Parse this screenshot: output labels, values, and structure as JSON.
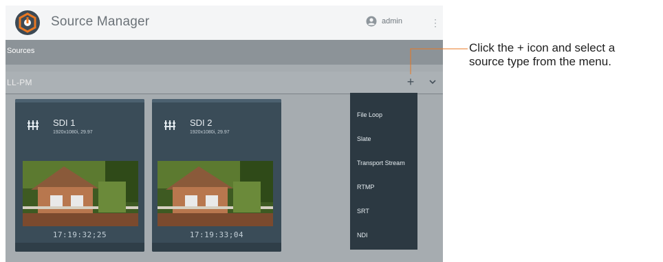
{
  "app": {
    "title": "Source Manager",
    "user": "admin"
  },
  "sources": {
    "title": "Sources",
    "group": "LL-PM"
  },
  "cards": [
    {
      "name": "SDI 1",
      "resolution": "1920x1080i, 29.97",
      "timecode": "17:19:32;25"
    },
    {
      "name": "SDI 2",
      "resolution": "1920x1080i, 29.97",
      "timecode": "17:19:33;04"
    }
  ],
  "menu": {
    "items": [
      {
        "label": "File Loop"
      },
      {
        "label": "Slate"
      },
      {
        "label": "Transport Stream"
      },
      {
        "label": "RTMP"
      },
      {
        "label": "SRT"
      },
      {
        "label": "NDI"
      }
    ]
  },
  "callout": {
    "line1": "Click the + icon and select a",
    "line2": "source type from the menu."
  },
  "colors": {
    "accent_line": "#e87722",
    "logo_orange": "#e87722",
    "menu_bg": "#2c3942",
    "card_bg": "#3a4c58"
  }
}
